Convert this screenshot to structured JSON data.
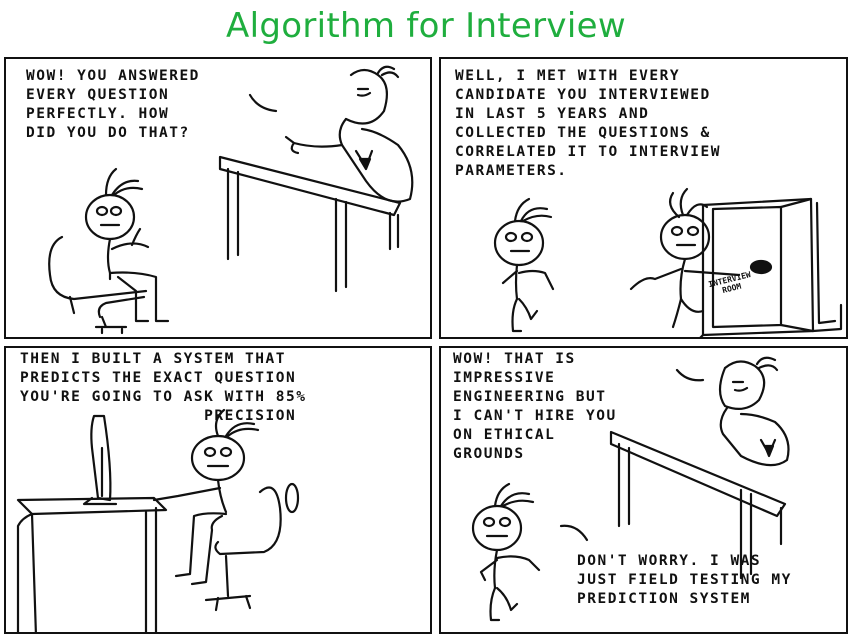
{
  "comic": {
    "title": "Algorithm for Interview",
    "title_color": "#1fae3e",
    "panels": [
      {
        "speech": "WOW! YOU ANSWERED\nEVERY QUESTION\nPERFECTLY. HOW\nDID YOU DO THAT?"
      },
      {
        "speech": "WELL, I MET WITH EVERY\nCANDIDATE YOU INTERVIEWED\nIN LAST 5 YEARS AND\nCOLLECTED THE QUESTIONS &\nCORRELATED IT TO INTERVIEW\nPARAMETERS.",
        "door_sign": "INTERVIEW\nROOM"
      },
      {
        "speech": "THEN I BUILT A SYSTEM THAT\nPREDICTS THE EXACT QUESTION\nYOU'RE GOING TO ASK WITH 85%\n                  PRECISION"
      },
      {
        "speech_top": "WOW! THAT IS\nIMPRESSIVE\nENGINEERING BUT\nI CAN'T HIRE YOU\nON ETHICAL\nGROUNDS",
        "speech_bottom": "DON'T WORRY. I WAS\nJUST FIELD TESTING MY\nPREDICTION SYSTEM"
      }
    ]
  }
}
